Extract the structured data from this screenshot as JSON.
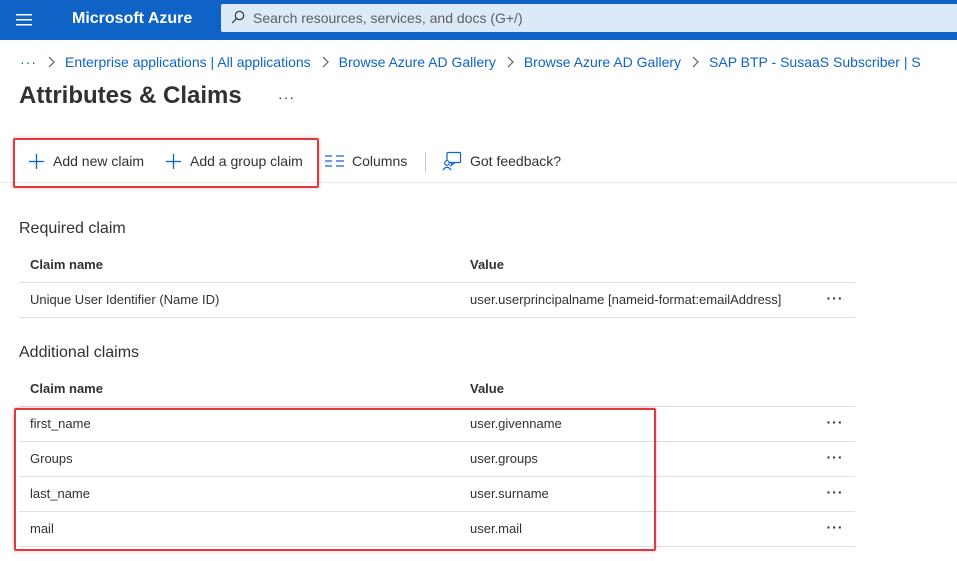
{
  "header": {
    "brand": "Microsoft Azure",
    "search_placeholder": "Search resources, services, and docs (G+/)"
  },
  "breadcrumb": {
    "more": "···",
    "items": [
      "Enterprise applications | All applications",
      "Browse Azure AD Gallery",
      "Browse Azure AD Gallery",
      "SAP BTP - SusaaS Subscriber | S"
    ]
  },
  "page": {
    "title": "Attributes & Claims",
    "more": "···"
  },
  "toolbar": {
    "add_new_claim": "Add new claim",
    "add_group_claim": "Add a group claim",
    "columns": "Columns",
    "feedback": "Got feedback?"
  },
  "required": {
    "heading": "Required claim",
    "col_name": "Claim name",
    "col_value": "Value",
    "rows": [
      {
        "name": "Unique User Identifier (Name ID)",
        "value": "user.userprincipalname [nameid-format:emailAddress]"
      }
    ]
  },
  "additional": {
    "heading": "Additional claims",
    "col_name": "Claim name",
    "col_value": "Value",
    "rows": [
      {
        "name": "first_name",
        "value": "user.givenname"
      },
      {
        "name": "Groups",
        "value": "user.groups"
      },
      {
        "name": "last_name",
        "value": "user.surname"
      },
      {
        "name": "mail",
        "value": "user.mail"
      }
    ]
  },
  "colors": {
    "header_bg": "#0f62c6",
    "link": "#0f62c6",
    "highlight": "#e03a41"
  },
  "icons": [
    "hamburger-icon",
    "search-icon",
    "chevron-right-icon",
    "plus-icon",
    "columns-icon",
    "feedback-icon",
    "more-icon"
  ]
}
